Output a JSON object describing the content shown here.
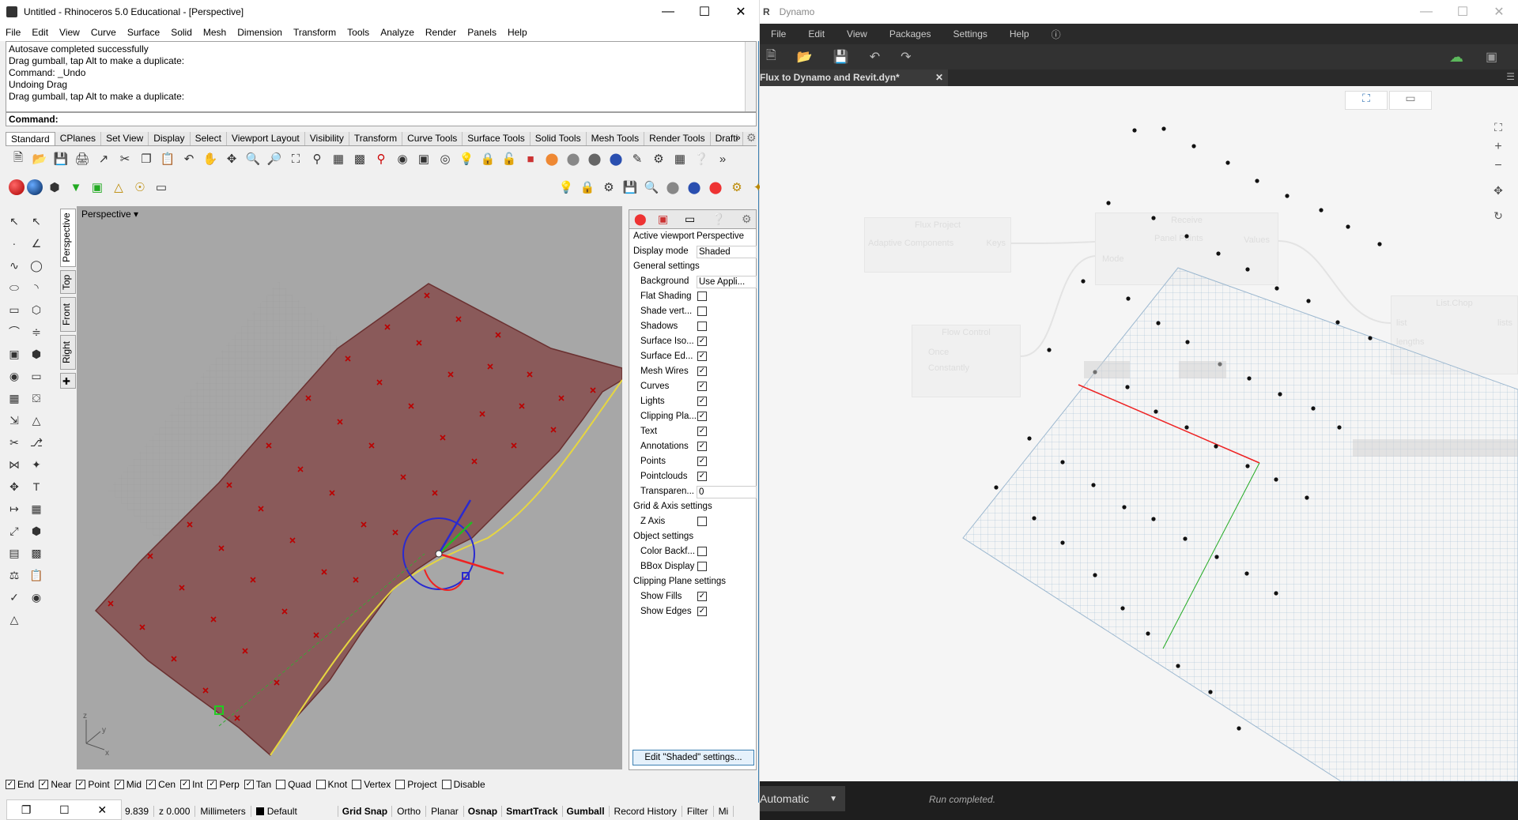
{
  "rhino": {
    "title": "Untitled - Rhinoceros 5.0 Educational - [Perspective]",
    "menu": [
      "File",
      "Edit",
      "View",
      "Curve",
      "Surface",
      "Solid",
      "Mesh",
      "Dimension",
      "Transform",
      "Tools",
      "Analyze",
      "Render",
      "Panels",
      "Help"
    ],
    "history": [
      "Autosave completed successfully",
      "Drag gumball, tap Alt to make a duplicate:",
      "Command: _Undo",
      "Undoing Drag",
      "Drag gumball, tap Alt to make a duplicate:"
    ],
    "command_label": "Command:",
    "toolbar_tabs": [
      "Standard",
      "CPlanes",
      "Set View",
      "Display",
      "Select",
      "Viewport Layout",
      "Visibility",
      "Transform",
      "Curve Tools",
      "Surface Tools",
      "Solid Tools",
      "Mesh Tools",
      "Render Tools",
      "Drafti"
    ],
    "viewport_tabs": [
      "Perspective",
      "Top",
      "Front",
      "Right"
    ],
    "viewport_label": "Perspective",
    "properties": {
      "active_viewport_label": "Active viewport",
      "active_viewport": "Perspective",
      "display_mode_label": "Display mode",
      "display_mode": "Shaded",
      "general": "General settings",
      "background_label": "Background",
      "background_value": "Use Appli...",
      "items": [
        {
          "label": "Flat Shading",
          "checked": false
        },
        {
          "label": "Shade vert...",
          "checked": false
        },
        {
          "label": "Shadows",
          "checked": false
        },
        {
          "label": "Surface Iso...",
          "checked": true
        },
        {
          "label": "Surface Ed...",
          "checked": true
        },
        {
          "label": "Mesh Wires",
          "checked": true
        },
        {
          "label": "Curves",
          "checked": true
        },
        {
          "label": "Lights",
          "checked": true
        },
        {
          "label": "Clipping Pla...",
          "checked": true
        },
        {
          "label": "Text",
          "checked": true
        },
        {
          "label": "Annotations",
          "checked": true
        },
        {
          "label": "Points",
          "checked": true
        },
        {
          "label": "Pointclouds",
          "checked": true
        }
      ],
      "transparency_label": "Transparen...",
      "transparency_value": "0",
      "grid_section": "Grid & Axis settings",
      "zaxis_label": "Z Axis",
      "object_section": "Object settings",
      "object_items": [
        {
          "label": "Color Backf...",
          "checked": false
        },
        {
          "label": "BBox Display",
          "checked": false
        }
      ],
      "clip_section": "Clipping Plane settings",
      "clip_items": [
        {
          "label": "Show Fills",
          "checked": true
        },
        {
          "label": "Show Edges",
          "checked": true
        }
      ],
      "edit_button": "Edit \"Shaded\" settings..."
    },
    "osnap": [
      {
        "label": "End",
        "checked": true
      },
      {
        "label": "Near",
        "checked": true
      },
      {
        "label": "Point",
        "checked": true
      },
      {
        "label": "Mid",
        "checked": true
      },
      {
        "label": "Cen",
        "checked": true
      },
      {
        "label": "Int",
        "checked": true
      },
      {
        "label": "Perp",
        "checked": true
      },
      {
        "label": "Tan",
        "checked": true
      },
      {
        "label": "Quad",
        "checked": false
      },
      {
        "label": "Knot",
        "checked": false
      },
      {
        "label": "Vertex",
        "checked": false
      },
      {
        "label": "Project",
        "checked": false
      },
      {
        "label": "Disable",
        "checked": false
      }
    ],
    "status": {
      "coord": "9.839",
      "z": "z 0.000",
      "units": "Millimeters",
      "layer": "Default",
      "toggles": [
        "Grid Snap",
        "Ortho",
        "Planar",
        "Osnap",
        "SmartTrack",
        "Gumball",
        "Record History",
        "Filter",
        "Mi"
      ]
    },
    "colors": {
      "surface": "#8a5a5a",
      "accent": "#3c7fb1"
    }
  },
  "dynamo": {
    "title": "Dynamo",
    "menu": [
      "File",
      "Edit",
      "View",
      "Packages",
      "Settings",
      "Help"
    ],
    "tab": "Flux to Dynamo and Revit.dyn*",
    "run_mode": "Automatic",
    "run_status": "Run completed.",
    "ghost_nodes": {
      "flux_project": "Flux Project",
      "adaptive": "Adaptive Components",
      "keys": "Keys",
      "receive": "Receive",
      "panel_points": "Panel Points",
      "values": "Values",
      "flow_control": "Flow Control",
      "once": "Once",
      "constantly": "Constantly",
      "mode": "Mode",
      "list_chop": "List.Chop",
      "list": "list",
      "lengths": "lengths",
      "lists": "lists"
    }
  }
}
